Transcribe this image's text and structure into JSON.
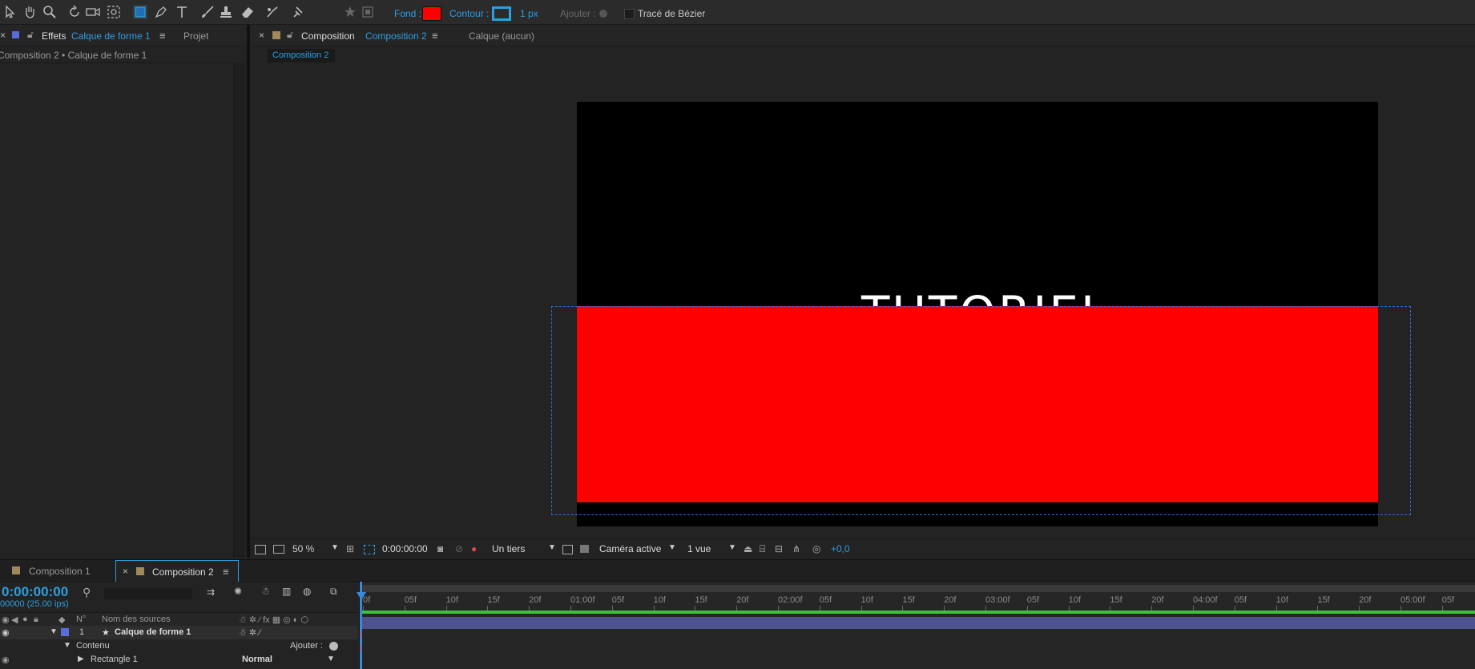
{
  "toolbar": {
    "fill_label": "Fond :",
    "fill_color": "#ff0000",
    "stroke_label": "Contour :",
    "stroke_color": "#2d9ee0",
    "stroke_width": "1 px",
    "add_label": "Ajouter :",
    "bezier_label": "Tracé de Bézier"
  },
  "effects_panel": {
    "tab_label": "Effets",
    "layer_name": "Calque de forme 1",
    "project_tab": "Projet",
    "breadcrumb": "Composition 2 • Calque de forme 1"
  },
  "comp_panel": {
    "tab_prefix": "Composition",
    "comp_name": "Composition 2",
    "layer_tab": "Calque  (aucun)",
    "chip_label": "Composition 2",
    "canvas_title": "TUTORIEL",
    "shape_fill": "#ff0000"
  },
  "viewer_bar": {
    "zoom": "50 %",
    "timecode": "0:00:00:00",
    "grid": "Un tiers",
    "camera": "Caméra active",
    "views": "1 vue",
    "exposure": "+0,0"
  },
  "timeline": {
    "tabs": [
      "Composition 1",
      "Composition 2"
    ],
    "timecode": "0:00:00:00",
    "frames": "00000 (25.00 ips)",
    "columns": {
      "num": "N°",
      "source": "Nom des sources"
    },
    "layer": {
      "index": "1",
      "name": "Calque de forme 1"
    },
    "contents_label": "Contenu",
    "add_label": "Ajouter :",
    "rectangle_label": "Rectangle 1",
    "blend_mode": "Normal",
    "ruler": [
      "0f",
      "05f",
      "10f",
      "15f",
      "20f",
      "01:00f",
      "05f",
      "10f",
      "15f",
      "20f",
      "02:00f",
      "05f",
      "10f",
      "15f",
      "20f",
      "03:00f",
      "05f",
      "10f",
      "15f",
      "20f",
      "04:00f",
      "05f",
      "10f",
      "15f",
      "20f",
      "05:00f",
      "05f"
    ]
  }
}
